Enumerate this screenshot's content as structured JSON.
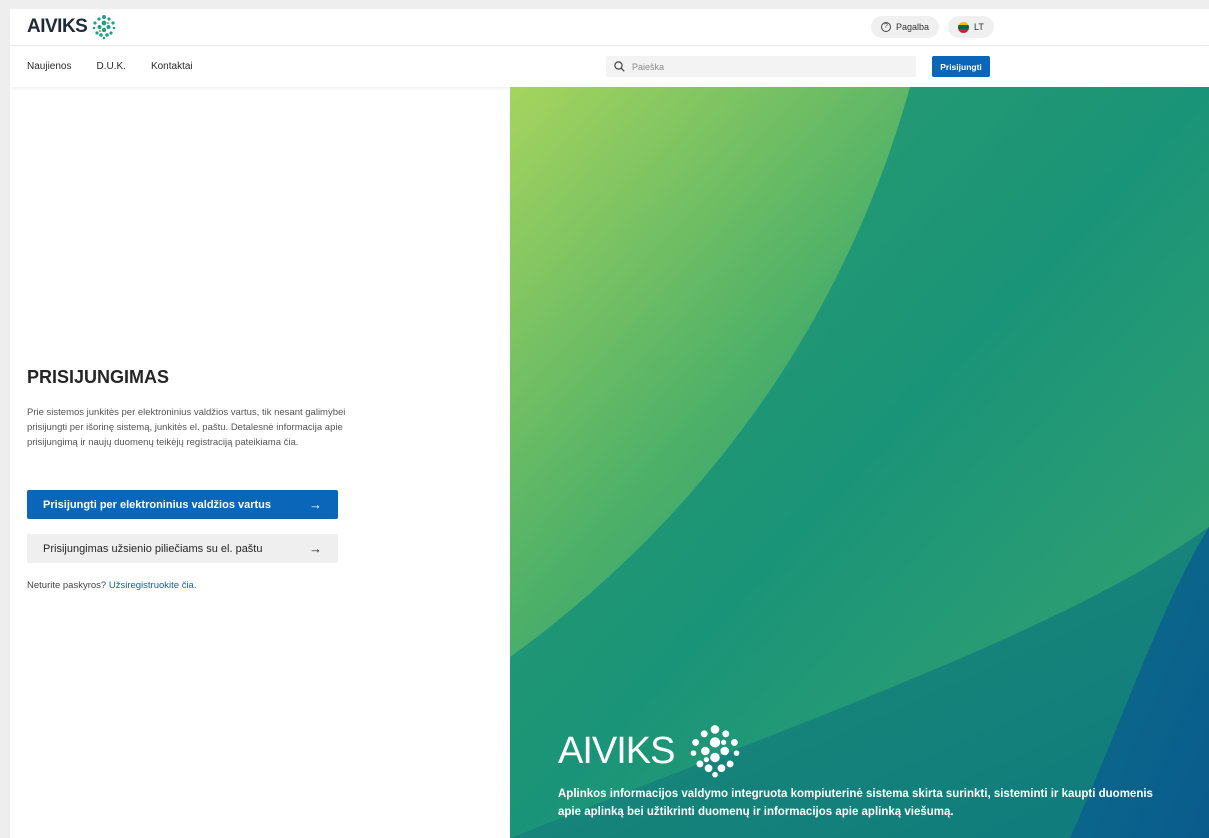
{
  "header": {
    "logo_text": "AIVIKS",
    "help_label": "Pagalba",
    "lang_label": "LT",
    "flag_colors": [
      "#fdb913",
      "#006a44",
      "#c1272d"
    ]
  },
  "nav": {
    "links": [
      "Naujienos",
      "D.U.K.",
      "Kontaktai"
    ],
    "search_placeholder": "Paieška",
    "login_label": "Prisijungti"
  },
  "login": {
    "title": "PRISIJUNGIMAS",
    "description": "Prie sistemos junkitės per elektroninius valdžios vartus, tik nesant galimybei prisijungti per išorinę sistemą, junkitės el. paštu. Detalesnė informacija apie prisijungimą ir naujų duomenų teikėjų registraciją pateikiama čia.",
    "primary_button": "Prisijungti per elektroninius valdžios vartus",
    "secondary_button": "Prisijungimas užsienio piliečiams su el. paštu",
    "no_account_text": "Neturite paskyros?",
    "register_link": "Užsiregistruokite čia."
  },
  "hero": {
    "logo_text": "AIVIKS",
    "tagline": "Aplinkos informacijos valdymo integruota kompiuterinė sistema skirta surinkti, sisteminti ir kaupti duomenis apie aplinką bei užtikrinti duomenų ir informacijos apie aplinką viešumą."
  },
  "colors": {
    "primary": "#0a66b8",
    "hero_green": "#2f9c6e",
    "hero_lime": "#a6d45e",
    "hero_blue": "#0d5f8f"
  }
}
